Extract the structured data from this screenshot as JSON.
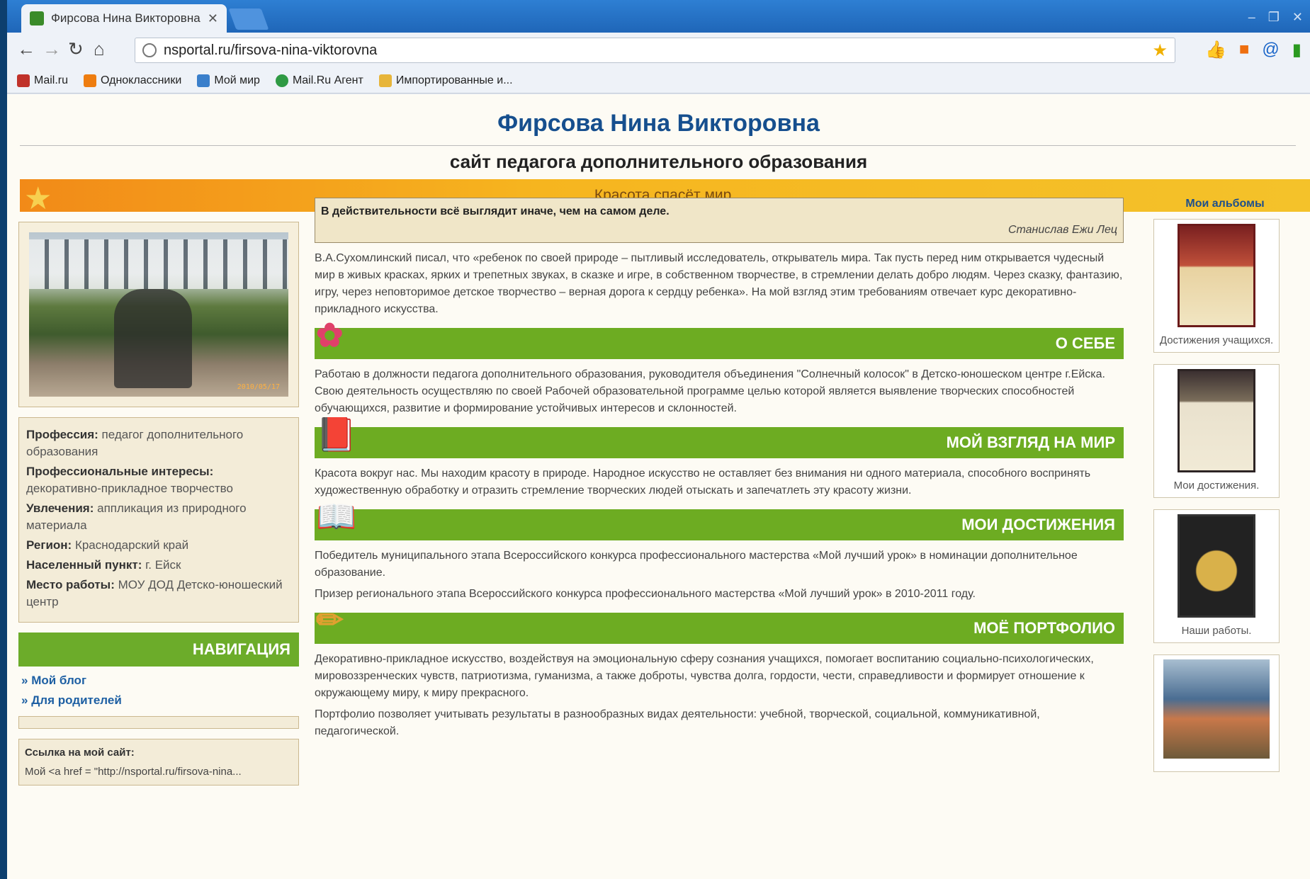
{
  "browser": {
    "tab_title": "Фирсова Нина Викторовна |",
    "url": "nsportal.ru/firsova-nina-viktorovna",
    "bookmarks": [
      "Mail.ru",
      "Одноклассники",
      "Мой мир",
      "Mail.Ru Агент",
      "Импортированные и..."
    ]
  },
  "site": {
    "title": "Фирсова Нина Викторовна",
    "subtitle": "сайт педагога дополнительного образования",
    "motto": "Красота спасёт мир."
  },
  "profile": {
    "photo_date": "2010/05/17",
    "fields": [
      {
        "label": "Профессия:",
        "value": "педагог дополнительного образования"
      },
      {
        "label": "Профессиональные интересы:",
        "value": "декоративно-прикладное творчество"
      },
      {
        "label": "Увлечения:",
        "value": "аппликация из природного материала"
      },
      {
        "label": "Регион:",
        "value": "Краснодарский край"
      },
      {
        "label": "Населенный пункт:",
        "value": "г. Ейск"
      },
      {
        "label": "Место работы:",
        "value": "МОУ ДОД Детско-юношеский центр"
      }
    ]
  },
  "navigation": {
    "title": "НАВИГАЦИЯ",
    "items": [
      "Мой блог",
      "Для родителей"
    ]
  },
  "site_link": {
    "label": "Ссылка на мой сайт:",
    "code": "Мой <a href = \"http://nsportal.ru/firsova-nina..."
  },
  "quote": {
    "text": "В действительности всё выглядит иначе, чем на самом деле.",
    "author": "Станислав Ежи Лец"
  },
  "content": {
    "intro": "В.А.Сухомлинский писал, что «ребенок по своей природе – пытливый исследователь, открыватель мира. Так пусть перед ним открывается чудесный мир в живых красках, ярких и трепетных звуках, в сказке и игре, в собственном творчестве, в стремлении делать добро людям. Через сказку, фантазию, игру, через неповторимое детское творчество – верная дорога к сердцу ребенка». На мой взгляд этим требованиям отвечает курс декоративно-прикладного искусства.",
    "sections": [
      {
        "title": "О СЕБЕ",
        "paragraphs": [
          "Работаю в должности педагога дополнительного образования, руководителя объединения \"Солнечный колосок\" в Детско-юношеском центре г.Ейска. Свою деятельность осуществляю по своей Рабочей образовательной программе целью которой является выявление творческих способностей обучающихся, развитие и формирование устойчивых интересов и склонностей."
        ]
      },
      {
        "title": "МОЙ ВЗГЛЯД НА МИР",
        "paragraphs": [
          "Красота вокруг нас. Мы находим красоту в природе. Народное искусство не оставляет без внимания ни одного материала, способного воспринять художественную обработку и отразить стремление творческих людей отыскать и запечатлеть эту красоту жизни."
        ]
      },
      {
        "title": "МОИ ДОСТИЖЕНИЯ",
        "paragraphs": [
          "Победитель муниципального этапа Всероссийского конкурса профессионального мастерства «Мой лучший урок» в номинации дополнительное образование.",
          "Призер регионального этапа Всероссийского конкурса профессионального мастерства «Мой лучший урок» в 2010-2011 году."
        ]
      },
      {
        "title": "МОЁ ПОРТФОЛИО",
        "paragraphs": [
          "Декоративно-прикладное искусство, воздействуя на эмоциональную сферу сознания учащихся, помогает воспитанию социально-психологических, мировоззренческих чувств, патриотизма, гуманизма, а также доброты, чувства долга, гордости, чести, справедливости и формирует отношение к окружающему миру, к миру прекрасного.",
          "Портфолио позволяет учитывать результаты в разнообразных видах деятельности: учебной, творческой, социальной, коммуникативной, педагогической."
        ]
      }
    ]
  },
  "albums": {
    "title": "Мои альбомы",
    "items": [
      "Достижения учащихся.",
      "Мои достижения.",
      "Наши работы.",
      ""
    ]
  },
  "colors": {
    "accent_green": "#6dac22",
    "title_blue": "#164f8e",
    "motto_orange": "#f6b51f"
  }
}
